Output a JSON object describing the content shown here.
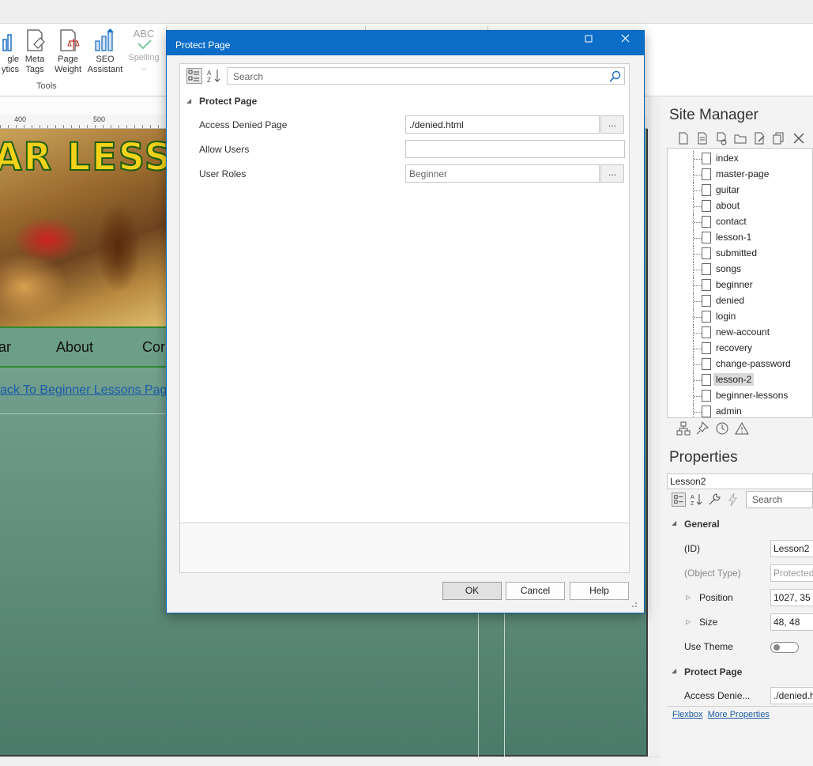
{
  "ribbon": {
    "buttons": [
      {
        "label": "gle\nytics",
        "icon": "analytics-icon"
      },
      {
        "label": "Meta\nTags",
        "icon": "meta-tags-icon"
      },
      {
        "label": "Page\nWeight",
        "icon": "page-weight-icon"
      },
      {
        "label": "SEO\nAssistant",
        "icon": "seo-assistant-icon"
      },
      {
        "label": "Spelling",
        "icon": "spelling-icon",
        "badge": "ABC"
      }
    ],
    "group_label": "Tools"
  },
  "canvas": {
    "ruler_labels": [
      "400",
      "500"
    ],
    "banner_text": "AR LESS",
    "nav_items": [
      "ar",
      "About",
      "Cor"
    ],
    "back_link": "ack To Beginner Lessons Pag"
  },
  "dialog": {
    "title": "Protect Page",
    "search_placeholder": "Search",
    "section_title": "Protect Page",
    "rows": [
      {
        "label": "Access Denied Page",
        "value": "./denied.html",
        "has_button": true
      },
      {
        "label": "Allow Users",
        "value": "",
        "has_button": false
      },
      {
        "label": "User Roles",
        "value": "Beginner",
        "has_button": true
      }
    ],
    "ellipsis": "...",
    "buttons": {
      "ok": "OK",
      "cancel": "Cancel",
      "help": "Help"
    }
  },
  "site_manager": {
    "title": "Site Manager",
    "pages": [
      "index",
      "master-page",
      "guitar",
      "about",
      "contact",
      "lesson-1",
      "submitted",
      "songs",
      "beginner",
      "denied",
      "login",
      "new-account",
      "recovery",
      "change-password",
      "lesson-2",
      "beginner-lessons",
      "admin"
    ],
    "selected": "lesson-2"
  },
  "properties": {
    "title": "Properties",
    "object_name": "Lesson2",
    "search_placeholder": "Search",
    "general_section": "General",
    "id_label": "(ID)",
    "id_value": "Lesson2",
    "object_type_label": "(Object Type)",
    "object_type_value": "Protected",
    "position_label": "Position",
    "position_value": "1027, 35",
    "size_label": "Size",
    "size_value": "48, 48",
    "use_theme_label": "Use Theme",
    "protect_section": "Protect Page",
    "access_denied_label": "Access Denie...",
    "access_denied_value": "./denied.h",
    "links": {
      "flexbox": "Flexbox",
      "more": "More Properties"
    }
  },
  "colors": {
    "titlebar": "#0b6dc8",
    "accent": "#1a5ca8",
    "page_bg": "#6e9b89"
  }
}
